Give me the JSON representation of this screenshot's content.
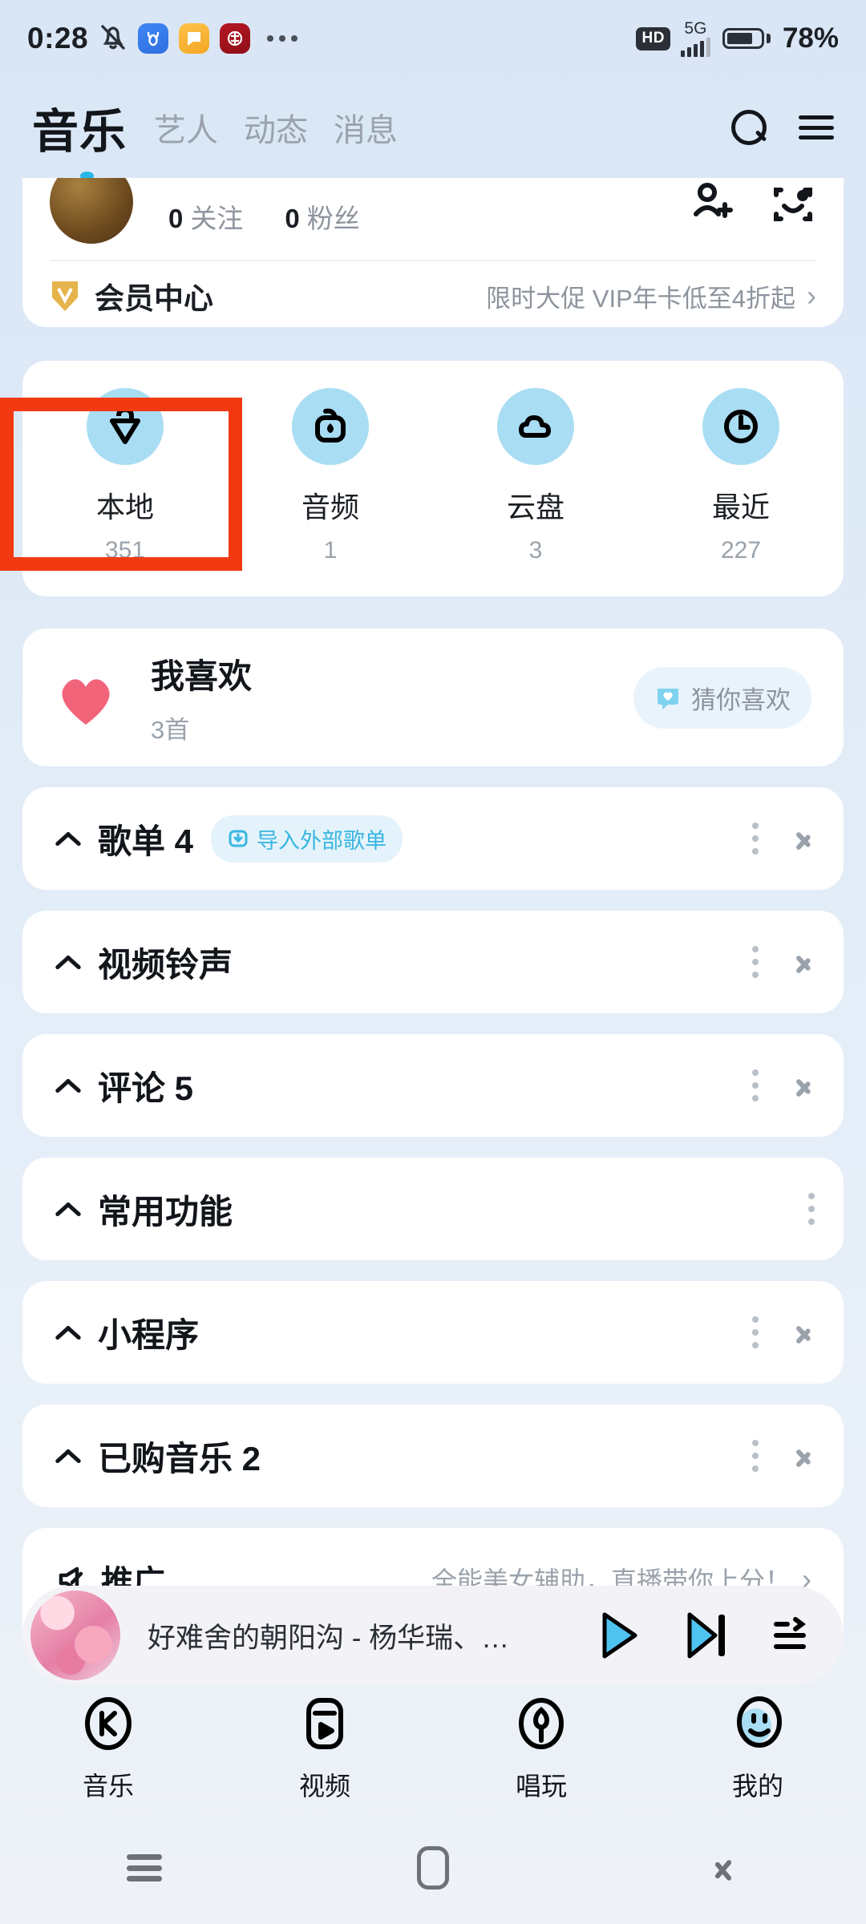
{
  "status_bar": {
    "time": "0:28",
    "mute_icon": "bell-muted-icon",
    "app_icons": [
      "ox-app-icon",
      "note-app-icon",
      "coin-app-icon"
    ],
    "overflow_icon": "more-dots-icon",
    "hd_label": "HD",
    "network_label": "5G",
    "signal_icon": "signal-bars-icon",
    "battery_percent": "78%",
    "battery_level": 78
  },
  "header": {
    "brand": "音乐",
    "tabs": [
      {
        "label": "艺人"
      },
      {
        "label": "动态"
      },
      {
        "label": "消息"
      }
    ],
    "search_icon": "search-icon",
    "menu_icon": "hamburger-menu-icon"
  },
  "profile": {
    "following_count": "0",
    "following_label": "关注",
    "followers_count": "0",
    "followers_label": "粉丝",
    "add_friend_icon": "add-friend-icon",
    "scan_icon": "scan-face-icon"
  },
  "vip": {
    "icon": "vip-diamond-icon",
    "title": "会员中心",
    "promo": "限时大促 VIP年卡低至4折起",
    "chevron": "chevron-right-icon"
  },
  "quick_grid": [
    {
      "label": "本地",
      "count": "351",
      "icon": "local-device-icon"
    },
    {
      "label": "音频",
      "count": "1",
      "icon": "audio-flame-icon"
    },
    {
      "label": "云盘",
      "count": "3",
      "icon": "cloud-icon"
    },
    {
      "label": "最近",
      "count": "227",
      "icon": "clock-icon"
    }
  ],
  "favorites": {
    "icon": "heart-icon",
    "title": "我喜欢",
    "subtitle": "3首",
    "pill_label": "猜你喜欢",
    "pill_icon": "recommend-heart-icon"
  },
  "list_rows": [
    {
      "label": "歌单 4",
      "tag": "导入外部歌单",
      "tag_icon": "import-icon",
      "has_kebab": true,
      "has_chevron": true
    },
    {
      "label": "视频铃声",
      "tag": "",
      "has_kebab": true,
      "has_chevron": true
    },
    {
      "label": "评论 5",
      "tag": "",
      "has_kebab": true,
      "has_chevron": true
    },
    {
      "label": "常用功能",
      "tag": "",
      "has_kebab": true,
      "has_chevron": false
    },
    {
      "label": "小程序",
      "tag": "",
      "has_kebab": true,
      "has_chevron": true
    },
    {
      "label": "已购音乐 2",
      "tag": "",
      "has_kebab": true,
      "has_chevron": true
    }
  ],
  "promo_row": {
    "icon": "megaphone-icon",
    "label": "推广",
    "note": "全能美女辅助，直播带你上分！",
    "chevron": "chevron-right-icon"
  },
  "mini_player": {
    "album_art": "album-art-floral",
    "title": "好难舍的朝阳沟 - 杨华瑞、…",
    "play_icon": "play-icon",
    "next_icon": "next-track-icon",
    "queue_icon": "playlist-queue-icon"
  },
  "bottom_nav": [
    {
      "label": "音乐",
      "icon": "music-k-icon",
      "active": false
    },
    {
      "label": "视频",
      "icon": "video-icon",
      "active": false
    },
    {
      "label": "唱玩",
      "icon": "sing-mic-icon",
      "active": false
    },
    {
      "label": "我的",
      "icon": "profile-smiley-icon",
      "active": true
    }
  ],
  "system_nav": {
    "recents_icon": "recents-icon",
    "home_icon": "home-icon",
    "back_icon": "back-icon"
  },
  "annotation": {
    "color": "#f23a12",
    "target": "本地"
  }
}
